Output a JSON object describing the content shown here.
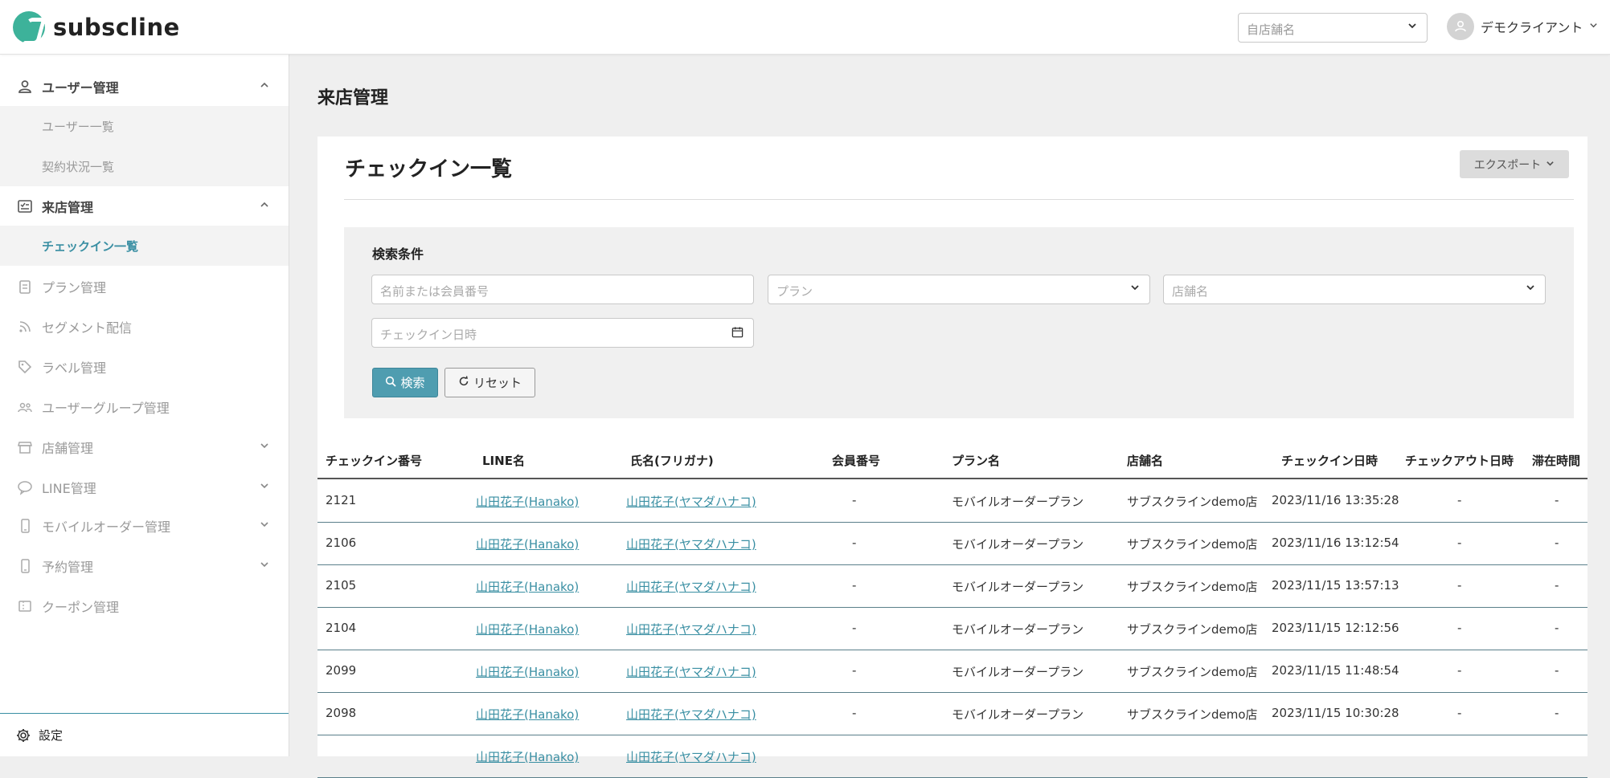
{
  "header": {
    "logo_text": "subscline",
    "store_select_placeholder": "自店舗名",
    "user_name": "デモクライアント"
  },
  "sidebar": {
    "items": [
      {
        "label": "ユーザー管理",
        "icon": "user-icon",
        "expanded": true
      },
      {
        "label": "ユーザー一覧",
        "sub": true
      },
      {
        "label": "契約状況一覧",
        "sub": true
      },
      {
        "label": "来店管理",
        "icon": "checklist-icon",
        "expanded": true
      },
      {
        "label": "チェックイン一覧",
        "sub": true,
        "current": true
      },
      {
        "label": "プラン管理",
        "icon": "clipboard-icon"
      },
      {
        "label": "セグメント配信",
        "icon": "rss-icon"
      },
      {
        "label": "ラベル管理",
        "icon": "tag-icon"
      },
      {
        "label": "ユーザーグループ管理",
        "icon": "group-icon"
      },
      {
        "label": "店舗管理",
        "icon": "store-icon"
      },
      {
        "label": "LINE管理",
        "icon": "chat-icon"
      },
      {
        "label": "モバイルオーダー管理",
        "icon": "phone-icon"
      },
      {
        "label": "予約管理",
        "icon": "phone-icon"
      },
      {
        "label": "クーポン管理",
        "icon": "coupon-icon"
      }
    ],
    "settings_label": "設定"
  },
  "main": {
    "page_title": "来店管理",
    "card_title": "チェックイン一覧",
    "export_label": "エクスポート",
    "search": {
      "label": "検索条件",
      "name_placeholder": "名前または会員番号",
      "plan_placeholder": "プラン",
      "store_placeholder": "店舗名",
      "date_placeholder": "チェックイン日時",
      "search_button": "検索",
      "reset_button": "リセット"
    },
    "table": {
      "headers": [
        "チェックイン番号",
        "LINE名",
        "氏名(フリガナ)",
        "会員番号",
        "プラン名",
        "店舗名",
        "チェックイン日時",
        "チェックアウト日時",
        "滞在時間"
      ],
      "rows": [
        {
          "id": "2121",
          "line": "山田花子(Hanako)",
          "name": "山田花子(ヤマダハナコ)",
          "member": "-",
          "plan": "モバイルオーダープラン",
          "store": "サブスクラインdemo店",
          "checkin": "2023/11/16 13:35:28",
          "checkout": "-",
          "stay": "-"
        },
        {
          "id": "2106",
          "line": "山田花子(Hanako)",
          "name": "山田花子(ヤマダハナコ)",
          "member": "-",
          "plan": "モバイルオーダープラン",
          "store": "サブスクラインdemo店",
          "checkin": "2023/11/16 13:12:54",
          "checkout": "-",
          "stay": "-"
        },
        {
          "id": "2105",
          "line": "山田花子(Hanako)",
          "name": "山田花子(ヤマダハナコ)",
          "member": "-",
          "plan": "モバイルオーダープラン",
          "store": "サブスクラインdemo店",
          "checkin": "2023/11/15 13:57:13",
          "checkout": "-",
          "stay": "-"
        },
        {
          "id": "2104",
          "line": "山田花子(Hanako)",
          "name": "山田花子(ヤマダハナコ)",
          "member": "-",
          "plan": "モバイルオーダープラン",
          "store": "サブスクラインdemo店",
          "checkin": "2023/11/15 12:12:56",
          "checkout": "-",
          "stay": "-"
        },
        {
          "id": "2099",
          "line": "山田花子(Hanako)",
          "name": "山田花子(ヤマダハナコ)",
          "member": "-",
          "plan": "モバイルオーダープラン",
          "store": "サブスクラインdemo店",
          "checkin": "2023/11/15 11:48:54",
          "checkout": "-",
          "stay": "-"
        },
        {
          "id": "2098",
          "line": "山田花子(Hanako)",
          "name": "山田花子(ヤマダハナコ)",
          "member": "-",
          "plan": "モバイルオーダープラン",
          "store": "サブスクラインdemo店",
          "checkin": "2023/11/15 10:30:28",
          "checkout": "-",
          "stay": "-"
        },
        {
          "id": "",
          "line": "山田花子(Hanako)",
          "name": "山田花子(ヤマダハナコ)",
          "member": "",
          "plan": "",
          "store": "",
          "checkin": "",
          "checkout": "",
          "stay": ""
        }
      ]
    }
  },
  "colors": {
    "accent": "#3a8fa3",
    "brand": "#3db29a",
    "search_button": "#4f9db0"
  }
}
